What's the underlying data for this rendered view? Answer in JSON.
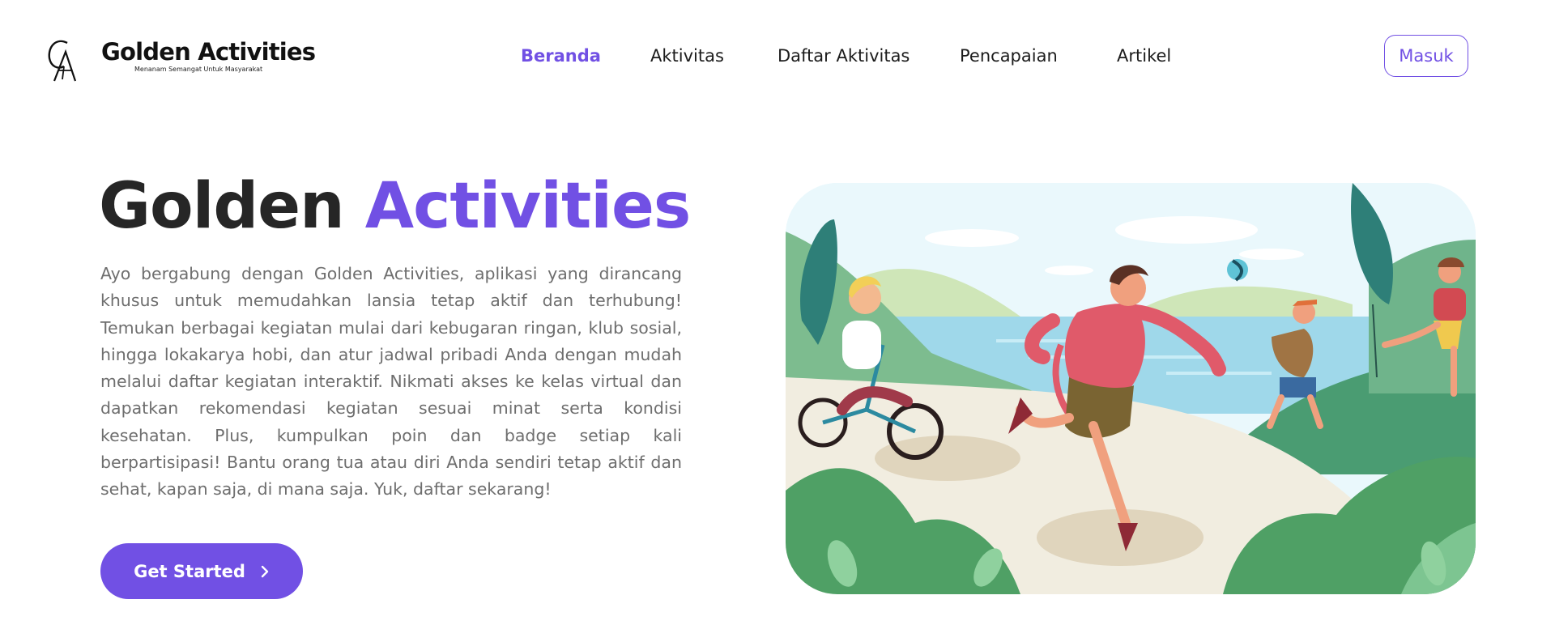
{
  "brand": {
    "name": "Golden Activities",
    "tagline": "Menanam Semangat Untuk Masyarakat",
    "logo_icon": "ga-monogram-icon"
  },
  "nav": {
    "items": [
      {
        "label": "Beranda",
        "active": true
      },
      {
        "label": "Aktivitas",
        "active": false
      },
      {
        "label": "Daftar Aktivitas",
        "active": false
      },
      {
        "label": "Pencapaian",
        "active": false
      },
      {
        "label": "Artikel",
        "active": false
      }
    ],
    "login_label": "Masuk"
  },
  "hero": {
    "title_part1": "Golden",
    "title_part2": "Activities",
    "description": "Ayo bergabung dengan Golden Activities, aplikasi yang dirancang khusus untuk memudahkan lansia tetap aktif dan terhubung! Temukan berbagai kegiatan mulai dari kebugaran ringan, klub sosial, hingga lokakarya hobi, dan atur jadwal pribadi Anda dengan mudah melalui daftar kegiatan interaktif. Nikmati akses ke kelas virtual dan dapatkan rekomendasi kegiatan sesuai minat serta kondisi kesehatan. Plus, kumpulkan poin dan badge setiap kali berpartisipasi! Bantu orang tua atau diri Anda sendiri tetap aktif dan sehat, kapan saja, di mana saja. Yuk, daftar sekarang!",
    "cta_label": "Get Started",
    "cta_icon": "chevron-right-icon",
    "illustration": "people-exercising-outdoors-illustration"
  },
  "colors": {
    "accent": "#7150e4",
    "heading": "#262626",
    "body_text": "#6e6e6e"
  }
}
